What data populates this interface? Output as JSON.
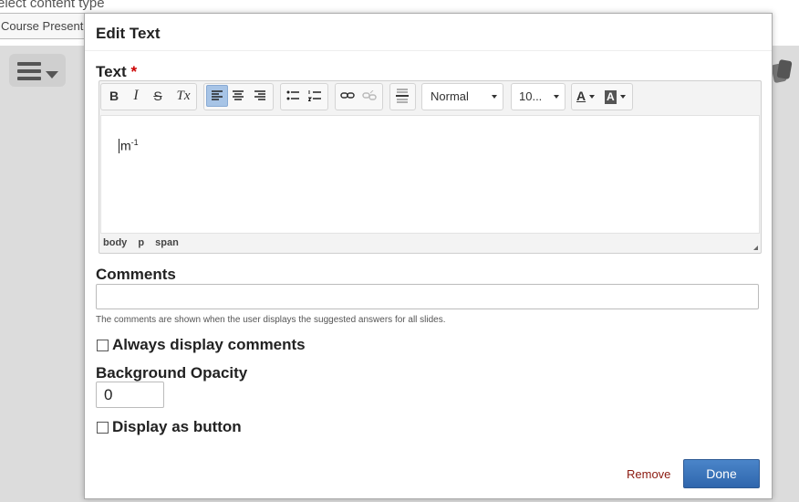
{
  "background": {
    "content_type_label": "elect content type",
    "content_type_value": "Course Presentation"
  },
  "dialog": {
    "title": "Edit Text",
    "text_label": "Text",
    "required_mark": "*",
    "toolbar": {
      "bold": "B",
      "italic": "I",
      "strike": "S",
      "clear_format": "Tx",
      "format_value": "Normal",
      "size_value": "10...",
      "text_color": "A",
      "bg_color": "A"
    },
    "editor_content": {
      "base": "m",
      "superscript": "-1"
    },
    "elements_path": [
      "body",
      "p",
      "span"
    ],
    "comments_label": "Comments",
    "comments_value": "",
    "comments_help": "The comments are shown when the user displays the suggested answers for all slides.",
    "always_display_label": "Always display comments",
    "background_opacity_label": "Background Opacity",
    "background_opacity_value": "0",
    "display_as_button_label": "Display as button",
    "remove_label": "Remove",
    "done_label": "Done"
  }
}
